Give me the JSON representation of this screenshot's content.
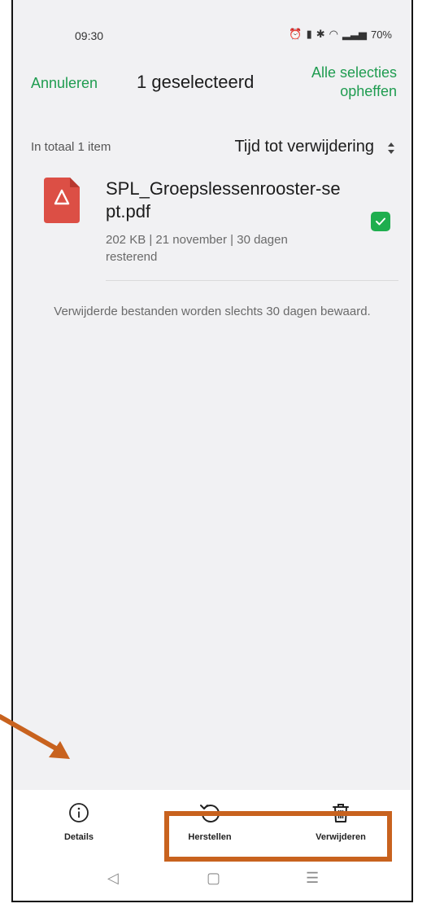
{
  "status_bar": {
    "time": "09:30",
    "battery": "70%"
  },
  "header": {
    "cancel_label": "Annuleren",
    "title": "1 geselecteerd",
    "deselect_label": "Alle selecties opheffen"
  },
  "list_header": {
    "total": "In totaal 1 item",
    "sort_label": "Tijd tot verwijdering"
  },
  "file": {
    "name": "SPL_Groepslessenrooster-sept.pdf",
    "meta": "202 KB | 21 november | 30 dagen resterend",
    "icon": "pdf-icon",
    "selected": true
  },
  "note": "Verwijderde bestanden worden slechts 30 dagen bewaard.",
  "actions": [
    {
      "label": "Details",
      "icon": "info-icon"
    },
    {
      "label": "Herstellen",
      "icon": "restore-icon"
    },
    {
      "label": "Verwijderen",
      "icon": "trash-icon"
    }
  ],
  "colors": {
    "accent": "#1f9c50",
    "check": "#1fae4f",
    "pdf": "#dc4f45",
    "annotation": "#c8621e"
  }
}
